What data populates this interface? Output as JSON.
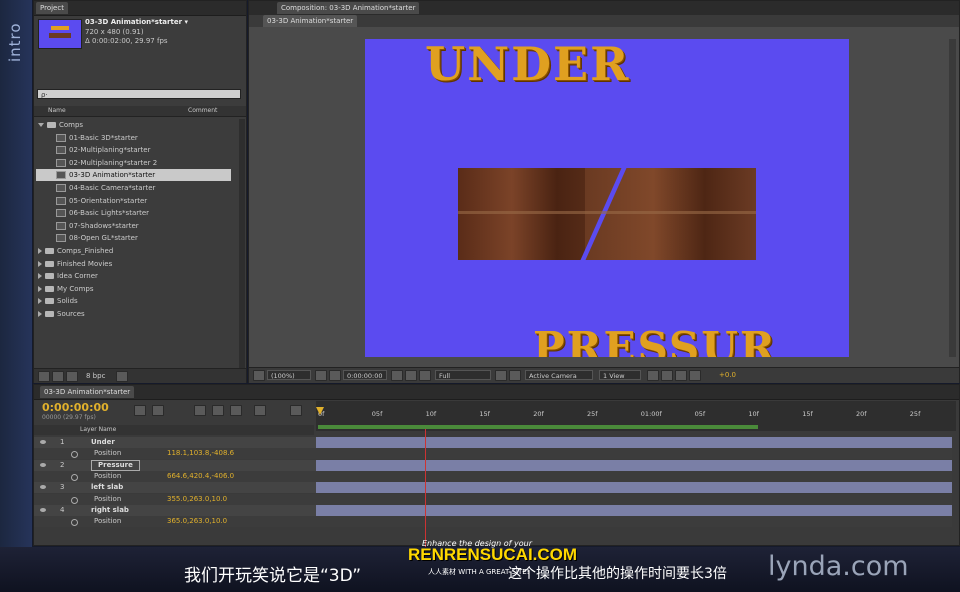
{
  "side_tab": "intro",
  "project": {
    "tab": "Project",
    "comp_name": "03-3D Animation*starter ▾",
    "comp_size": "720 x 480 (0.91)",
    "comp_duration": "Δ 0:00:02:00, 29.97 fps",
    "search_placeholder": "ρ·",
    "col_name": "Name",
    "col_comment": "Comment",
    "tree": [
      {
        "label": "Comps",
        "type": "folder",
        "open": true,
        "indent": 0
      },
      {
        "label": "01-Basic 3D*starter",
        "type": "comp",
        "indent": 1
      },
      {
        "label": "02-Multiplaning*starter",
        "type": "comp",
        "indent": 1
      },
      {
        "label": "02-Multiplaning*starter 2",
        "type": "comp",
        "indent": 1
      },
      {
        "label": "03-3D Animation*starter",
        "type": "comp",
        "indent": 1,
        "selected": true
      },
      {
        "label": "04-Basic Camera*starter",
        "type": "comp",
        "indent": 1
      },
      {
        "label": "05-Orientation*starter",
        "type": "comp",
        "indent": 1
      },
      {
        "label": "06-Basic Lights*starter",
        "type": "comp",
        "indent": 1
      },
      {
        "label": "07-Shadows*starter",
        "type": "comp",
        "indent": 1
      },
      {
        "label": "08-Open GL*starter",
        "type": "comp",
        "indent": 1
      },
      {
        "label": "Comps_Finished",
        "type": "folder",
        "indent": 0
      },
      {
        "label": "Finished Movies",
        "type": "folder",
        "indent": 0
      },
      {
        "label": "Idea Corner",
        "type": "folder",
        "indent": 0
      },
      {
        "label": "My Comps",
        "type": "folder",
        "indent": 0
      },
      {
        "label": "Solids",
        "type": "folder",
        "indent": 0
      },
      {
        "label": "Sources",
        "type": "folder",
        "indent": 0
      }
    ],
    "bpc": "8 bpc"
  },
  "composition": {
    "tab": "Composition: 03-3D Animation*starter",
    "sub_tab": "03-3D Animation*starter",
    "title_top": "UNDER",
    "title_bottom": "PRESSUR",
    "zoom": "(100%)",
    "timecode": "0:00:00:00",
    "resolution": "Full",
    "camera": "Active Camera",
    "views": "1 View",
    "exposure": "+0.0",
    "bg_color": "#5b4bf0"
  },
  "timeline": {
    "tab": "03-3D Animation*starter",
    "timecode": "0:00:00:00",
    "fps": "00000 (29.97 fps)",
    "col_layer": "Layer Name",
    "ruler": [
      "0f",
      "05f",
      "10f",
      "15f",
      "20f",
      "25f",
      "01:00f",
      "05f",
      "10f",
      "15f",
      "20f",
      "25f"
    ],
    "rows": [
      {
        "num": "1",
        "name": "Under",
        "prop": false
      },
      {
        "num": "",
        "name": "Position",
        "prop": true,
        "value": "118.1,103.8,-408.6"
      },
      {
        "num": "2",
        "name": "Pressure",
        "prop": false,
        "selected": true
      },
      {
        "num": "",
        "name": "Position",
        "prop": true,
        "value": "664.6,420.4,-406.0"
      },
      {
        "num": "3",
        "name": "left slab",
        "prop": false
      },
      {
        "num": "",
        "name": "Position",
        "prop": true,
        "value": "355.0,263.0,10.0"
      },
      {
        "num": "4",
        "name": "right slab",
        "prop": false
      },
      {
        "num": "",
        "name": "Position",
        "prop": true,
        "value": "365.0,263.0,10.0"
      }
    ]
  },
  "subtitle": "我们开玩笑说它是“3D”",
  "subtitle_tail": "这个操作比其他的操作时间要长3倍",
  "watermark_top": "Enhance the design of your",
  "watermark_main": "RENRENSUCAI.COM",
  "watermark_sub": "人人素材 WITH A GREAT SITE!",
  "brand": "lynda.com"
}
